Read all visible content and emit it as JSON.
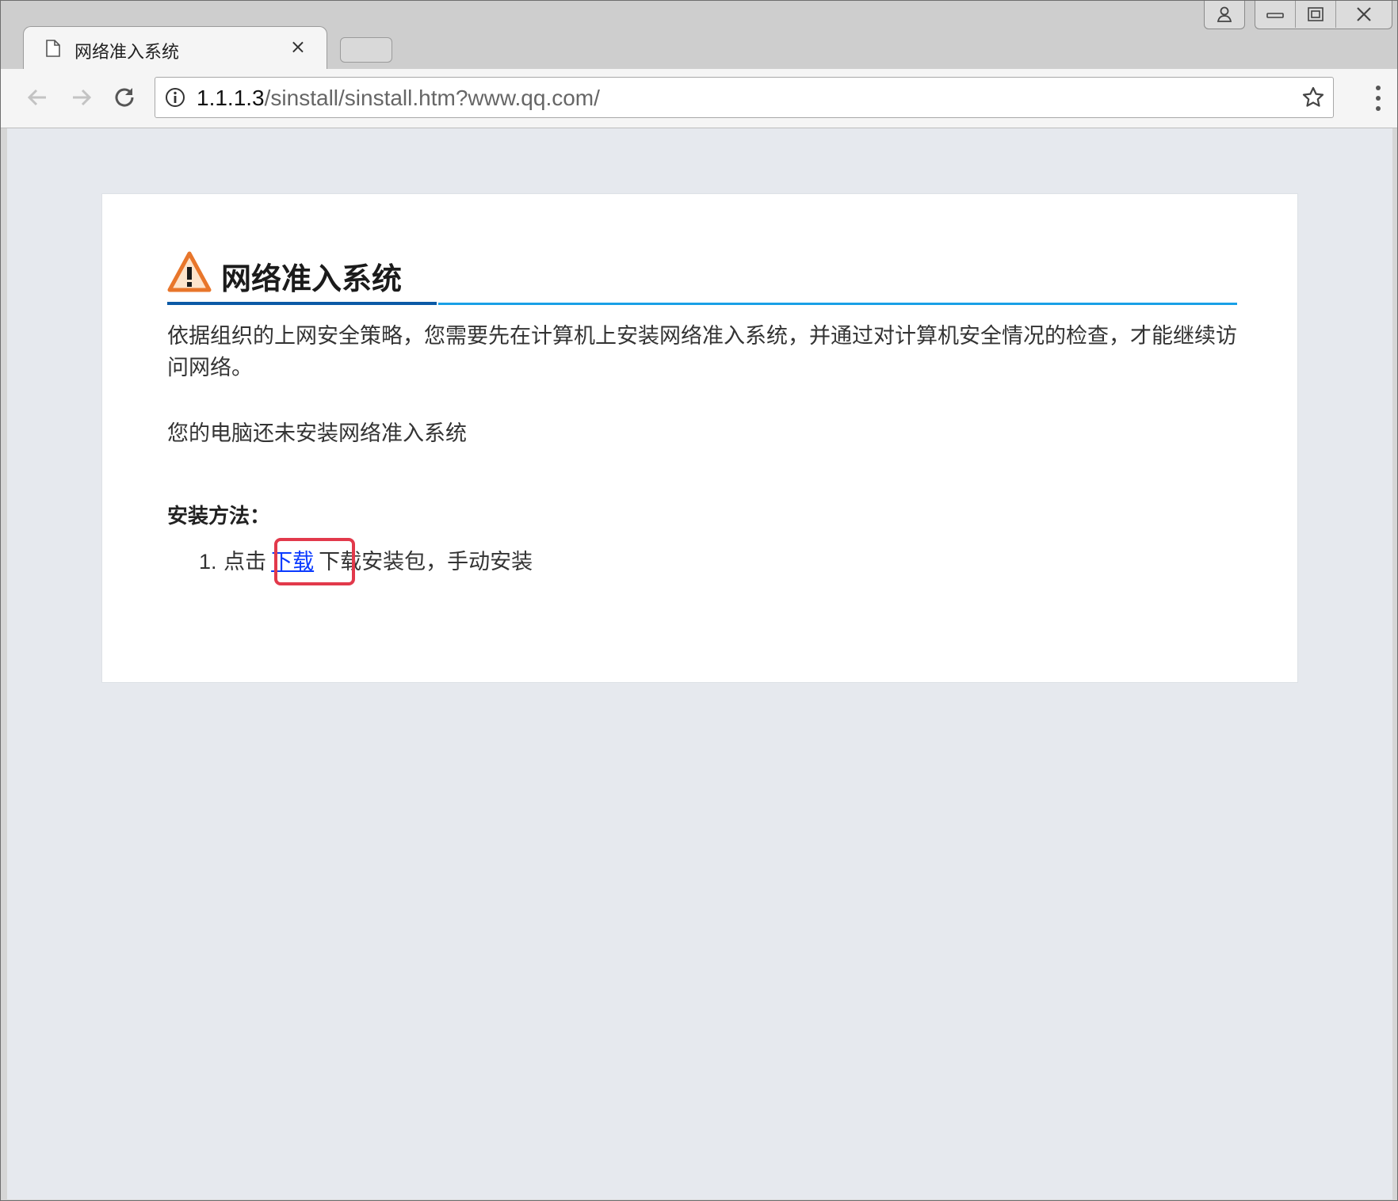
{
  "browser": {
    "tab_title": "网络准入系统",
    "tab_close": "×",
    "url_host": "1.1.1.3",
    "url_path": "/sinstall/sinstall.htm?www.qq.com/",
    "icons": {
      "tab": "page-icon",
      "back": "back-arrow-icon",
      "forward": "forward-arrow-icon",
      "reload": "reload-icon",
      "info": "info-icon",
      "bookmark": "star-icon",
      "menu": "kebab-menu-icon",
      "user": "user-icon",
      "minimize": "minimize-icon",
      "restore": "restore-icon",
      "close": "close-icon"
    }
  },
  "page": {
    "heading": "网络准入系统",
    "description": "依据组织的上网安全策略，您需要先在计算机上安装网络准入系统，并通过对计算机安全情况的检查，才能继续访问网络。",
    "status": "您的电脑还未安装网络准入系统",
    "method_title": "安装方法：",
    "step_number": "1.",
    "step_prefix": "点击",
    "download_link": "下载",
    "step_suffix": "下载安装包，手动安装"
  },
  "colors": {
    "link": "#0a3aff",
    "highlight": "#e2394b",
    "rule_dark": "#0b5aa6",
    "rule_light": "#19a0e6",
    "warning": "#e8762b"
  }
}
